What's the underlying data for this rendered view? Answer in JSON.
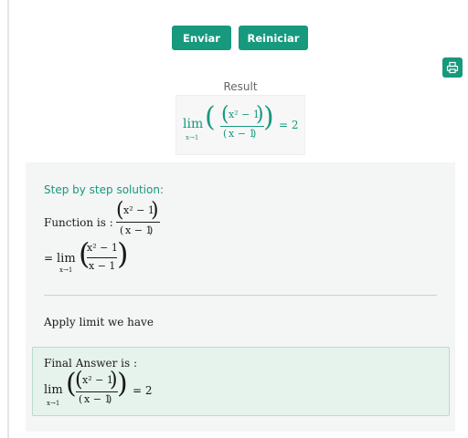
{
  "toolbar": {
    "submit_label": "Enviar",
    "reset_label": "Reiniciar"
  },
  "colors": {
    "accent": "#17997e",
    "panel_bg": "#f4f5f5",
    "final_bg": "#e6f3ec"
  },
  "icons": {
    "print": "print-icon"
  },
  "result": {
    "title": "Result",
    "lim": "lim",
    "sub": "x→1",
    "num": "x² − 1",
    "den": "x − 1",
    "eq": "= 2"
  },
  "solution": {
    "title": "Step by step solution:",
    "function_label": "Function is :",
    "num": "x² − 1",
    "den": "x − 1",
    "step_eq": "=",
    "lim": "lim",
    "sub": "x→1",
    "apply_text": "Apply limit we have",
    "final_label": "Final Answer is :",
    "final_eq": "= 2"
  }
}
